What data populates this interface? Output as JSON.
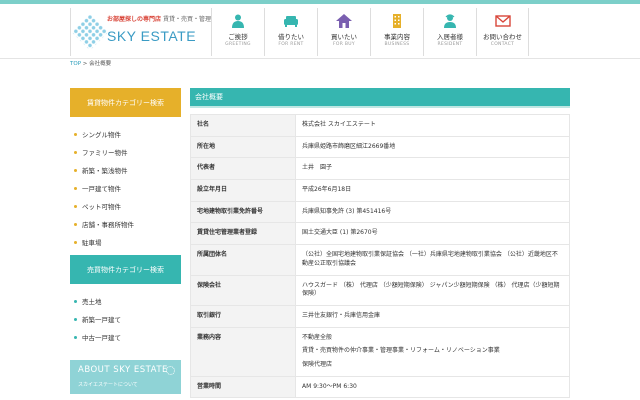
{
  "colors": {
    "accent": "#36b6b0",
    "yellow": "#e6b02a",
    "brand_blue": "#3a9bc4",
    "tag_red": "#d9463a"
  },
  "logo": {
    "tagline": "お部屋探しの専門店",
    "tagline_sub": "賃貸・売買・管理",
    "name": "SKY ESTATE"
  },
  "nav": [
    {
      "jp": "ご挨拶",
      "en": "GREETING",
      "icon": "person-icon"
    },
    {
      "jp": "借りたい",
      "en": "FOR RENT",
      "icon": "sofa-icon"
    },
    {
      "jp": "買いたい",
      "en": "FOR BUY",
      "icon": "house-icon"
    },
    {
      "jp": "事業内容",
      "en": "BUSINESS",
      "icon": "building-icon"
    },
    {
      "jp": "入居者様",
      "en": "RESIDENT",
      "icon": "resident-icon"
    },
    {
      "jp": "お問い合わせ",
      "en": "CONTACT",
      "icon": "mail-icon"
    }
  ],
  "breadcrumb": {
    "home": "TOP",
    "sep": ">",
    "current": "会社概要"
  },
  "sidebar": {
    "rent_title": "賃貸物件カテゴリー検索",
    "rent_items": [
      "シングル物件",
      "ファミリー物件",
      "新築・築浅物件",
      "一戸建て物件",
      "ペット可物件",
      "店舗・事務所物件",
      "駐車場"
    ],
    "sale_title": "売買物件カテゴリー検索",
    "sale_items": [
      "売土地",
      "新築一戸建て",
      "中古一戸建て"
    ],
    "about_en": "ABOUT SKY ESTATE",
    "about_jp": "スカイエステートについて"
  },
  "main": {
    "title": "会社概要",
    "rows": [
      {
        "key": "社名",
        "value": [
          "株式会社 スカイエステート"
        ]
      },
      {
        "key": "所在地",
        "value": [
          "兵庫県姫路市飾磨区細江2669番地"
        ]
      },
      {
        "key": "代表者",
        "value": [
          "土井　園子"
        ]
      },
      {
        "key": "設立年月日",
        "value": [
          "平成26年6月18日"
        ]
      },
      {
        "key": "宅地建物取引業免許番号",
        "value": [
          "兵庫県知事免許 (3) 第451416号"
        ]
      },
      {
        "key": "賃貸住宅管理業者登録",
        "value": [
          "国土交通大臣 (1) 第2670号"
        ]
      },
      {
        "key": "所属団体名",
        "value": [
          "（公社）全国宅地建物取引業保証協会 （一社）兵庫県宅地建物取引業協会 （公社）近畿地区不動産公正取引協議会"
        ]
      },
      {
        "key": "保険会社",
        "value": [
          "ハウスガード （株） 代理店 （少額短期保険） ジャパン少額短期保険 （株） 代理店（少額短期保険）"
        ]
      },
      {
        "key": "取引銀行",
        "value": [
          "三井住友銀行・兵庫信用金庫"
        ]
      },
      {
        "key": "業務内容",
        "value": [
          "不動産全般",
          "賃貸・売買物件の仲介事業・管理事業・リフォーム・リノベーション事業",
          "保険代理店"
        ]
      },
      {
        "key": "営業時間",
        "value": [
          "AM 9:30～PM 6:30"
        ]
      }
    ]
  }
}
